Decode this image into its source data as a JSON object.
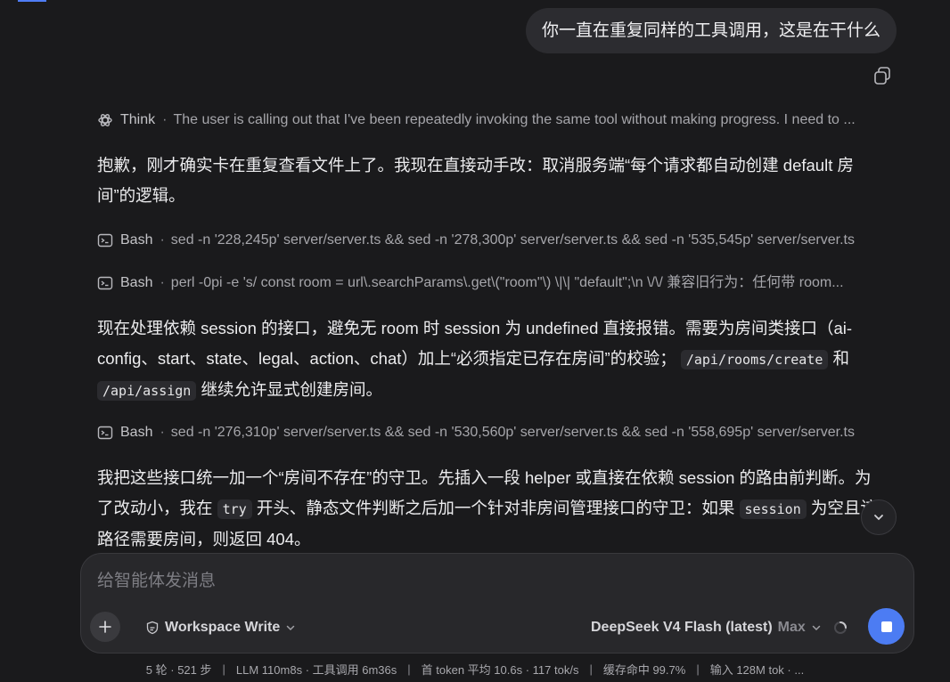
{
  "user_message": "你一直在重复同样的工具调用，这是在干什么",
  "think": {
    "label": "Think",
    "summary": "The user is calling out that I've been repeatedly invoking the same tool without making progress. I need to ..."
  },
  "assistant_1": {
    "text": "抱歉，刚才确实卡在重复查看文件上了。我现在直接动手改：取消服务端“每个请求都自动创建 default 房间”的逻辑。"
  },
  "tool_calls": [
    {
      "name": "Bash",
      "command": "sed -n '228,245p' server/server.ts && sed -n '278,300p' server/server.ts && sed -n '535,545p' server/server.ts"
    },
    {
      "name": "Bash",
      "command": "perl -0pi -e 's/ const room = url\\.searchParams\\.get\\(\"room\"\\) \\|\\| \"default\";\\n \\/\\/ 兼容旧行为：任何带 room..."
    },
    {
      "name": "Bash",
      "command": "sed -n '276,310p' server/server.ts && sed -n '530,560p' server/server.ts && sed -n '558,695p' server/server.ts"
    }
  ],
  "assistant_2": {
    "text_a": "现在处理依赖 session 的接口，避免无 room 时 session 为 undefined 直接报错。需要为房间类接口（ai-config、start、state、legal、action、chat）加上“必须指定已存在房间”的校验；",
    "code_a": "/api/rooms/create",
    "text_b": " 和 ",
    "code_b": "/api/assign",
    "text_c": " 继续允许显式创建房间。"
  },
  "assistant_3": {
    "text_a": "我把这些接口统一加一个“房间不存在”的守卫。先插入一段 helper 或直接在依赖 session 的路由前判断。为了改动小，我在 ",
    "code_a": "try",
    "text_b": " 开头、静态文件判断之后加一个针对非房间管理接口的守卫：如果 ",
    "code_b": "session",
    "text_c": " 为空且该路径需要房间，则返回 404。"
  },
  "composer": {
    "placeholder": "给智能体发消息",
    "mode": "Workspace Write",
    "model": "DeepSeek V4 Flash (latest)",
    "effort": "Max"
  },
  "status": [
    "5 轮 · 521 步",
    "LLM 110m8s · 工具调用 6m36s",
    "首 token 平均 10.6s · 117 tok/s",
    "缓存命中 99.7%",
    "输入 128M tok · ..."
  ],
  "colors": {
    "background": "#1a1a1c",
    "accent": "#4c7cf3"
  }
}
